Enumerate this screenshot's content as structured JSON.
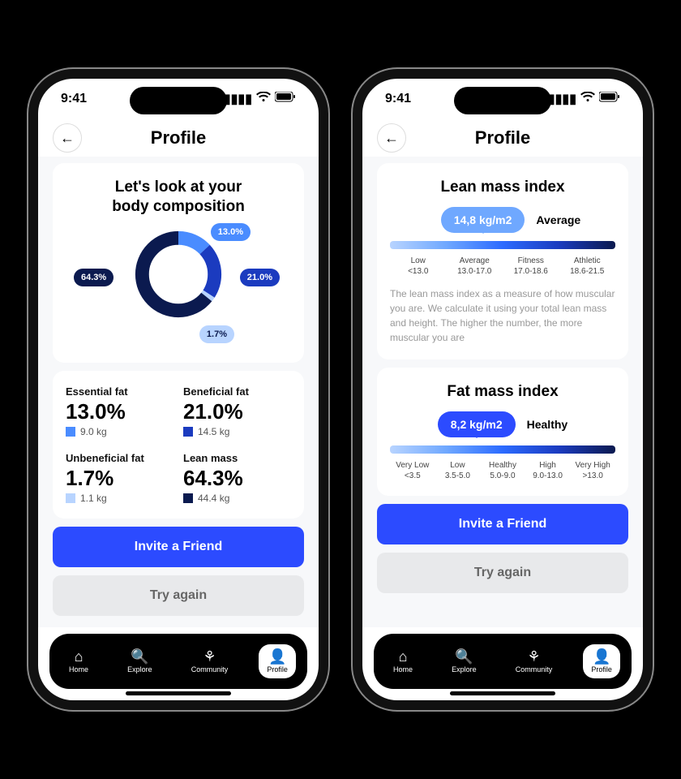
{
  "status": {
    "time": "9:41"
  },
  "header": {
    "title": "Profile"
  },
  "screen1": {
    "heading": "Let's look at your\nbody composition",
    "segments": [
      {
        "label": "13.0%",
        "color": "#4a8cff"
      },
      {
        "label": "21.0%",
        "color": "#1b3bbf"
      },
      {
        "label": "1.7%",
        "color": "#b8d4ff"
      },
      {
        "label": "64.3%",
        "color": "#0b1a4f"
      }
    ],
    "metrics": [
      {
        "name": "Essential fat",
        "value": "13.0%",
        "sub": "9.0 kg",
        "color": "#4a8cff"
      },
      {
        "name": "Beneficial fat",
        "value": "21.0%",
        "sub": "14.5 kg",
        "color": "#1b3bbf"
      },
      {
        "name": "Unbeneficial fat",
        "value": "1.7%",
        "sub": "1.1 kg",
        "color": "#b8d4ff"
      },
      {
        "name": "Lean mass",
        "value": "64.3%",
        "sub": "44.4 kg",
        "color": "#0b1a4f"
      }
    ]
  },
  "screen2": {
    "lmi": {
      "title": "Lean mass index",
      "value": "14,8 kg/m2",
      "category": "Average",
      "ticks": [
        {
          "name": "Low",
          "range": "<13.0"
        },
        {
          "name": "Average",
          "range": "13.0-17.0"
        },
        {
          "name": "Fitness",
          "range": "17.0-18.6"
        },
        {
          "name": "Athletic",
          "range": "18.6-21.5"
        }
      ],
      "desc": "The lean mass index as a measure of how muscular you are. We calculate it using your total lean mass and height. The higher the number, the more muscular you are"
    },
    "fmi": {
      "title": "Fat mass index",
      "value": "8,2 kg/m2",
      "category": "Healthy",
      "ticks": [
        {
          "name": "Very Low",
          "range": "<3.5"
        },
        {
          "name": "Low",
          "range": "3.5-5.0"
        },
        {
          "name": "Healthy",
          "range": "5.0-9.0"
        },
        {
          "name": "High",
          "range": "9.0-13.0"
        },
        {
          "name": "Very High",
          "range": ">13.0"
        }
      ]
    }
  },
  "buttons": {
    "invite": "Invite a Friend",
    "try_again": "Try again"
  },
  "tabs": [
    {
      "label": "Home"
    },
    {
      "label": "Explore"
    },
    {
      "label": "Community"
    },
    {
      "label": "Profile"
    }
  ],
  "chart_data": {
    "type": "pie",
    "title": "Body composition",
    "series": [
      {
        "name": "Essential fat",
        "value": 13.0,
        "mass_kg": 9.0
      },
      {
        "name": "Beneficial fat",
        "value": 21.0,
        "mass_kg": 14.5
      },
      {
        "name": "Unbeneficial fat",
        "value": 1.7,
        "mass_kg": 1.1
      },
      {
        "name": "Lean mass",
        "value": 64.3,
        "mass_kg": 44.4
      }
    ],
    "unit": "%"
  }
}
